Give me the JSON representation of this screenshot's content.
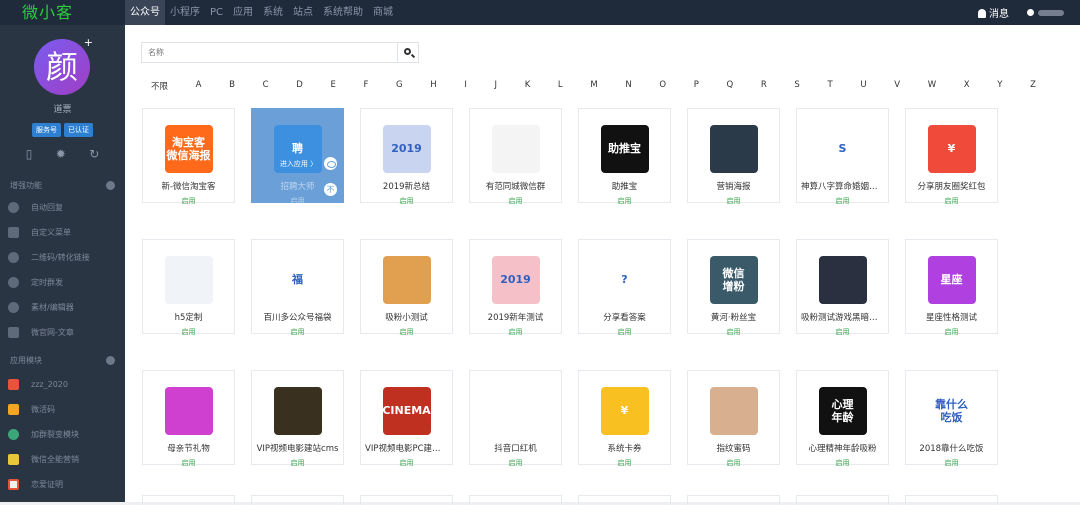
{
  "brand": "微小客",
  "topnav": [
    "公众号",
    "小程序",
    "PC",
    "应用",
    "系统",
    "站点",
    "系统帮助",
    "商城"
  ],
  "messages_label": "消息",
  "account": {
    "avatar_char": "颜",
    "name": "道票",
    "badges": [
      "服务号",
      "已认证"
    ]
  },
  "sidebar": {
    "section1": "增强功能",
    "items1": [
      "自动回复",
      "自定义菜单",
      "二维码/转化链接",
      "定时群发",
      "素材/编辑器",
      "微官网-文章"
    ],
    "section2": "应用模块",
    "items2": [
      "zzz_2020",
      "微活码",
      "加群裂变模块",
      "微信全能营销",
      "恋爱证明"
    ]
  },
  "search": {
    "placeholder": "名称"
  },
  "alphabet": [
    "不限",
    "A",
    "B",
    "C",
    "D",
    "E",
    "F",
    "G",
    "H",
    "I",
    "J",
    "K",
    "L",
    "M",
    "N",
    "O",
    "P",
    "Q",
    "R",
    "S",
    "T",
    "U",
    "V",
    "W",
    "X",
    "Y",
    "Z"
  ],
  "enter_label": "进入应用 〉",
  "not_label": "不",
  "apps": [
    {
      "name": "新-微信淘宝客",
      "action": "启用",
      "thumb_text": "淘宝客\n微信海报",
      "color": "#ff6a1a"
    },
    {
      "name": "招聘大师",
      "action": "启用",
      "thumb_text": "聘",
      "color": "#3d8fe0"
    },
    {
      "name": "2019新总结",
      "action": "启用",
      "thumb_text": "2019",
      "color": "#c9d4f0"
    },
    {
      "name": "有范同城微信群",
      "action": "启用",
      "thumb_text": "",
      "color": "#f4f4f4"
    },
    {
      "name": "助推宝",
      "action": "启用",
      "thumb_text": "助推宝",
      "color": "#111111"
    },
    {
      "name": "营销海报",
      "action": "启用",
      "thumb_text": "",
      "color": "#2a3a48"
    },
    {
      "name": "神算八字算命婚姻测...",
      "action": "启用",
      "thumb_text": "S",
      "color": "#ffffff"
    },
    {
      "name": "分享朋友圈奖红包",
      "action": "启用",
      "thumb_text": "¥",
      "color": "#f04a3a"
    },
    {
      "name": "h5定制",
      "action": "启用",
      "thumb_text": "",
      "color": "#f0f4f8"
    },
    {
      "name": "百川多公众号福袋",
      "action": "启用",
      "thumb_text": "福",
      "color": "#ffffff"
    },
    {
      "name": "吸粉小测试",
      "action": "启用",
      "thumb_text": "",
      "color": "#e0a050"
    },
    {
      "name": "2019新年测试",
      "action": "启用",
      "thumb_text": "2019",
      "color": "#f6c0c8"
    },
    {
      "name": "分享看答案",
      "action": "启用",
      "thumb_text": "?",
      "color": "#ffffff"
    },
    {
      "name": "黄河·粉丝宝",
      "action": "启用",
      "thumb_text": "微信\n增粉",
      "color": "#3a5a6a"
    },
    {
      "name": "吸粉测试游戏黑暗森...",
      "action": "启用",
      "thumb_text": "",
      "color": "#2a3040"
    },
    {
      "name": "星座性格测试",
      "action": "启用",
      "thumb_text": "星座",
      "color": "#b040e0"
    },
    {
      "name": "母亲节礼物",
      "action": "启用",
      "thumb_text": "",
      "color": "#d040d0"
    },
    {
      "name": "VIP视频电影建站cms",
      "action": "启用",
      "thumb_text": "",
      "color": "#3a3020"
    },
    {
      "name": "VIP视频电影PC建站...",
      "action": "启用",
      "thumb_text": "CINEMA",
      "color": "#c03020"
    },
    {
      "name": "抖音口红机",
      "action": "启用",
      "thumb_text": "",
      "color": "#ffffff"
    },
    {
      "name": "系统卡券",
      "action": "启用",
      "thumb_text": "¥",
      "color": "#f8c020"
    },
    {
      "name": "指纹蜜码",
      "action": "启用",
      "thumb_text": "",
      "color": "#d8b090"
    },
    {
      "name": "心理精神年龄吸粉",
      "action": "启用",
      "thumb_text": "心理\n年龄",
      "color": "#111111"
    },
    {
      "name": "2018靠什么吃饭",
      "action": "启用",
      "thumb_text": "靠什么\n吃饭",
      "color": "#ffffff"
    }
  ],
  "colors": {
    "topbar": "#1f2a3a",
    "sidebar": "#2a3544",
    "brand": "#2ecc40",
    "enable": "#37a34a",
    "hover": "#6b9fd8"
  }
}
